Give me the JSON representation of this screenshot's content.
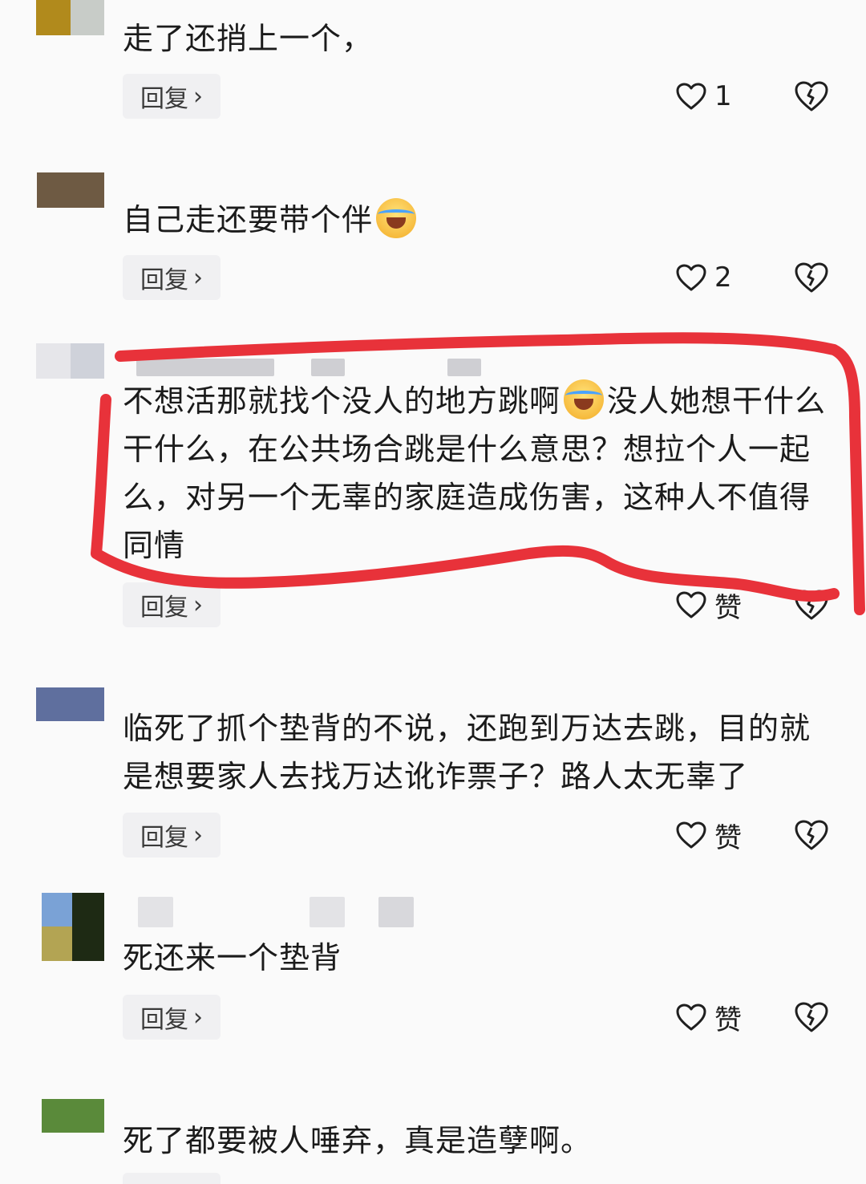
{
  "comments": [
    {
      "text": "走了还捎上一个，",
      "reply_label": "回复",
      "reply_chevron": "›",
      "like_label": "1",
      "avatar_colors": [
        "#b18a1c",
        "#c8ccc8"
      ]
    },
    {
      "text": "自己走还要带个伴",
      "emoji": "laughing-crying-emoji",
      "reply_label": "回复",
      "reply_chevron": "›",
      "like_label": "2",
      "avatar_colors": [
        "#6e5a43",
        "#6e5a43"
      ]
    },
    {
      "text_part1": "不想活那就找个没人的地方跳啊",
      "emoji": "laughing-crying-emoji",
      "text_part2": "没人她想干什么干什么，在公共场合跳是什么意思？想拉个人一起么，对另一个无辜的家庭造成伤害，这种人不值得同情",
      "reply_label": "回复",
      "reply_chevron": "›",
      "like_label": "赞",
      "avatar_colors": [
        "#e6e6ea",
        "#cfd2da"
      ]
    },
    {
      "text": "临死了抓个垫背的不说，还跑到万达去跳，目的就是想要家人去找万达讹诈票子？路人太无辜了",
      "reply_label": "回复",
      "reply_chevron": "›",
      "like_label": "赞",
      "avatar_colors": [
        "#5f6f9e",
        "#5f6f9e"
      ]
    },
    {
      "text": "死还来一个垫背",
      "reply_label": "回复",
      "reply_chevron": "›",
      "like_label": "赞",
      "avatar_colors": [
        "#7aa2d6",
        "#1e2a14",
        "#b3a453",
        "#1e2a14"
      ]
    },
    {
      "text": "死了都要被人唾弃，真是造孽啊。",
      "avatar_colors": [
        "#5a8a3a",
        "#5a8a3a"
      ]
    }
  ],
  "icons": {
    "like": "heart-outline-icon",
    "dislike": "broken-heart-icon"
  },
  "colors": {
    "annotation": "#e8323a",
    "reply_bg": "#f0f0f2"
  }
}
